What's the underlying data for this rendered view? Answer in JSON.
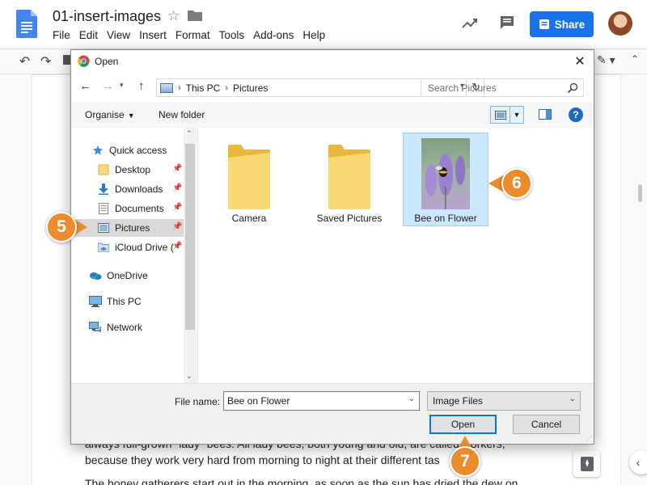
{
  "docs": {
    "document_title": "01-insert-images",
    "menu": [
      "File",
      "Edit",
      "View",
      "Insert",
      "Format",
      "Tools",
      "Add-ons",
      "Help"
    ],
    "share_label": "Share",
    "body_lines": [
      "always full-grown \"lady\" bees. All lady bees, both young and old, are called workers,",
      "because they work very hard from morning to night at their different tas",
      "The honey gatherers start out in the morning, as soon as the sun has dried the dew on"
    ]
  },
  "dialog": {
    "title": "Open",
    "address": [
      "This PC",
      "Pictures"
    ],
    "search_placeholder": "Search Pictures",
    "commands": {
      "organise": "Organise",
      "new_folder": "New folder"
    },
    "nav": [
      {
        "label": "Quick access",
        "icon": "star-icon",
        "pinned": false,
        "selected": false
      },
      {
        "label": "Desktop",
        "icon": "folder-icon",
        "pinned": true,
        "selected": false
      },
      {
        "label": "Downloads",
        "icon": "download-arrow-icon",
        "pinned": true,
        "selected": false
      },
      {
        "label": "Documents",
        "icon": "document-icon",
        "pinned": true,
        "selected": false
      },
      {
        "label": "Pictures",
        "icon": "pictures-icon",
        "pinned": true,
        "selected": true
      },
      {
        "label": "iCloud Drive (",
        "icon": "cloud-folder-icon",
        "pinned": true,
        "selected": false
      },
      {
        "label": "OneDrive",
        "icon": "onedrive-icon",
        "pinned": false,
        "selected": false
      },
      {
        "label": "This PC",
        "icon": "computer-icon",
        "pinned": false,
        "selected": false
      },
      {
        "label": "Network",
        "icon": "network-icon",
        "pinned": false,
        "selected": false
      }
    ],
    "files": [
      {
        "name": "Camera",
        "type": "folder",
        "selected": false
      },
      {
        "name": "Saved Pictures",
        "type": "folder",
        "selected": false
      },
      {
        "name": "Bee on Flower",
        "type": "image",
        "selected": true
      }
    ],
    "file_name_label": "File name:",
    "file_name_value": "Bee on Flower",
    "file_type": "Image Files",
    "open_label": "Open",
    "cancel_label": "Cancel"
  },
  "callouts": [
    "5",
    "6",
    "7"
  ],
  "colors": {
    "share_blue": "#1a73e8",
    "callout_orange": "#ec8b2b",
    "selection_blue": "#cce8ff",
    "open_button_border": "#0078d7"
  }
}
